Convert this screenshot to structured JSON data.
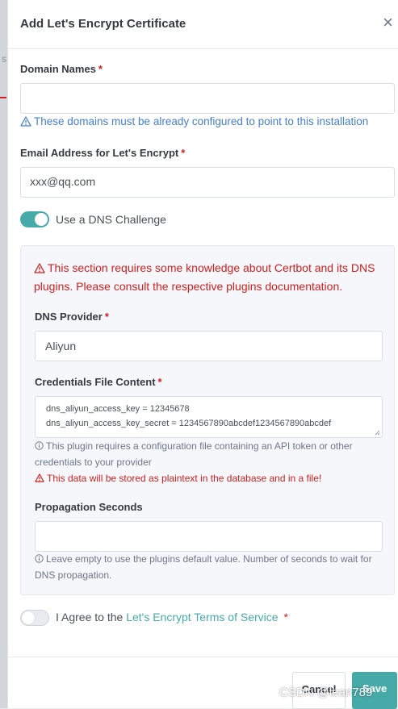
{
  "backdrop": {
    "tick_text": "s"
  },
  "modal": {
    "title": "Add Let's Encrypt Certificate",
    "close_symbol": "×"
  },
  "domain": {
    "label": "Domain Names",
    "required_mark": "*",
    "value": "",
    "hint": "These domains must be already configured to point to this installation"
  },
  "email": {
    "label": "Email Address for Let's Encrypt",
    "required_mark": "*",
    "value": "xxx@qq.com"
  },
  "dns_toggle": {
    "label": "Use a DNS Challenge",
    "state": "on"
  },
  "dns_panel": {
    "warning_line1": "This section requires some knowledge about Certbot and its DNS",
    "warning_line2": "plugins. Please consult the respective plugins documentation.",
    "provider_label": "DNS Provider",
    "provider_required": "*",
    "provider_value": "Aliyun",
    "credentials_label": "Credentials File Content",
    "credentials_required": "*",
    "credentials_lines": [
      "dns_aliyun_access_key = 12345678",
      "dns_aliyun_access_key_secret = 1234567890abcdef1234567890abcdef"
    ],
    "credentials_info_line1": "This plugin requires a configuration file containing an API token or other",
    "credentials_info_line2": "credentials to your provider",
    "plaintext_warning": "This data will be stored as plaintext in the database and in a file!",
    "propagation_label": "Propagation Seconds",
    "propagation_value": "",
    "propagation_info_line1": "Leave empty to use the plugins default value. Number of seconds to wait for",
    "propagation_info_line2": "DNS propagation."
  },
  "agree": {
    "prefix": "I Agree to the",
    "link_text": "Let's Encrypt Terms of Service",
    "required_mark": "*",
    "state": "off"
  },
  "footer": {
    "cancel_label": "Cancel",
    "save_label": "Save"
  },
  "watermark": "CSDN @lean789",
  "colors": {
    "accent": "#45aaa8",
    "danger": "#cd201f",
    "info": "#467fcf"
  },
  "icons": [
    "close-icon",
    "warning-triangle-icon",
    "info-circle-icon"
  ]
}
